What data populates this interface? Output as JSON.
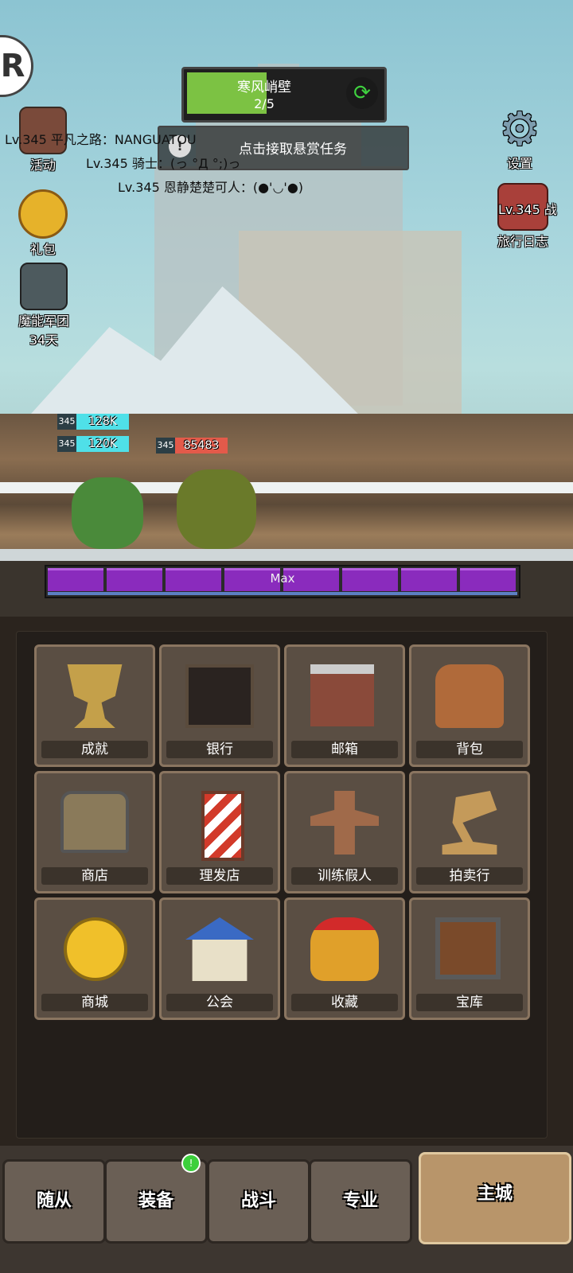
{
  "stage": {
    "name": "寒风峭壁",
    "progress": "2/5",
    "fill_fraction": 0.4
  },
  "bounty": {
    "label": "点击接取悬赏任务"
  },
  "left_icons": [
    {
      "label": "活动"
    },
    {
      "label": "礼包"
    },
    {
      "label": "魔能军团",
      "sub": "34天"
    }
  ],
  "right_icons": [
    {
      "label": "设置"
    },
    {
      "label": "旅行日志",
      "overlay": "Lv.345 战"
    }
  ],
  "chat": [
    "Lv.345 平凡之路：NANGUATOU",
    "Lv.345 骑士：(っ °Д °;)っ",
    "Lv.345 恩静楚楚可人：(●'◡'●)"
  ],
  "units": [
    {
      "level": "345",
      "hp": "128K"
    },
    {
      "level": "345",
      "hp": "120K"
    },
    {
      "level": "345",
      "hp": "85483"
    }
  ],
  "energy": {
    "segments": 8,
    "label": "Max"
  },
  "facilities": [
    {
      "label": "成就",
      "icon": "trophy-icon"
    },
    {
      "label": "银行",
      "icon": "safe-icon"
    },
    {
      "label": "邮箱",
      "icon": "mailbox-icon"
    },
    {
      "label": "背包",
      "icon": "backpack-icon"
    },
    {
      "label": "商店",
      "icon": "chest-icon"
    },
    {
      "label": "理发店",
      "icon": "barber-pole-icon"
    },
    {
      "label": "训练假人",
      "icon": "training-dummy-icon"
    },
    {
      "label": "拍卖行",
      "icon": "gavel-icon"
    },
    {
      "label": "商城",
      "icon": "gold-coin-icon"
    },
    {
      "label": "公会",
      "icon": "guild-house-icon"
    },
    {
      "label": "收藏",
      "icon": "helmet-icon"
    },
    {
      "label": "宝库",
      "icon": "vault-icon"
    }
  ],
  "nav": [
    {
      "label": "随从"
    },
    {
      "label": "装备",
      "badge": "!"
    },
    {
      "label": "战斗"
    },
    {
      "label": "专业"
    },
    {
      "label": "主城",
      "active": true
    }
  ],
  "colors": {
    "stage_fill": "#7cc243",
    "energy": "#8a2bbd",
    "hp_bar": "#4fe0e8",
    "badge": "#3ccf3c"
  }
}
